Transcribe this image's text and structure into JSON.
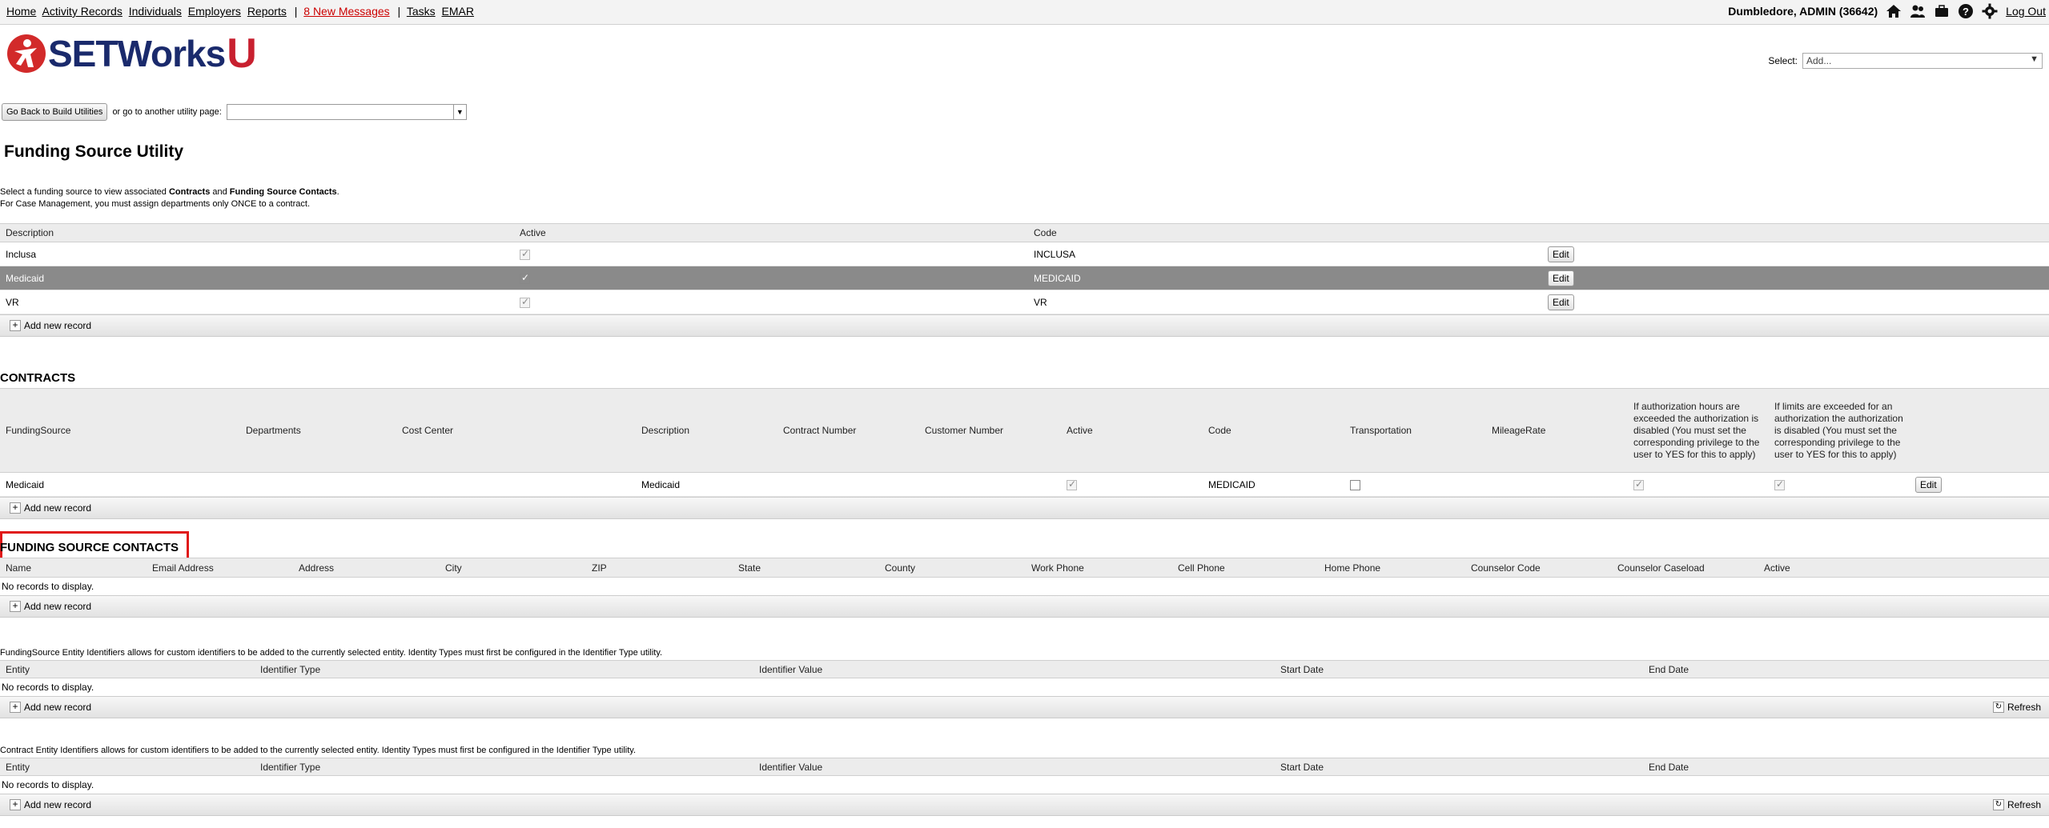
{
  "nav": {
    "links": [
      "Home",
      "Activity Records",
      "Individuals",
      "Employers",
      "Reports"
    ],
    "messages": "8 New Messages",
    "links2": [
      "Tasks",
      "EMAR"
    ],
    "user": "Dumbledore, ADMIN (36642)",
    "logout": "Log Out",
    "icons": [
      "home-icon",
      "people-icon",
      "briefcase-icon",
      "help-icon",
      "gear-icon"
    ]
  },
  "logo": {
    "text": "SETWorks",
    "u": "U"
  },
  "select": {
    "label": "Select:",
    "value": "Add..."
  },
  "utility": {
    "back_button": "Go Back to Build Utilities",
    "or_text": "or go to another utility page:",
    "select_value": ""
  },
  "page_title": "Funding Source Utility",
  "intro": {
    "line1_a": "Select a funding source to view associated ",
    "line1_b": "Contracts",
    "line1_c": " and ",
    "line1_d": "Funding Source Contacts",
    "line1_e": ".",
    "line2": "For Case Management, you must assign departments only ONCE to a contract."
  },
  "funding_grid": {
    "headers": [
      "Description",
      "Active",
      "Code",
      ""
    ],
    "rows": [
      {
        "description": "Inclusa",
        "active": true,
        "code": "INCLUSA",
        "edit": "Edit"
      },
      {
        "description": "Medicaid",
        "active": true,
        "code": "MEDICAID",
        "edit": "Edit"
      },
      {
        "description": "VR",
        "active": true,
        "code": "VR",
        "edit": "Edit"
      }
    ],
    "add": "Add new record"
  },
  "contracts": {
    "title": "CONTRACTS",
    "headers": [
      "FundingSource",
      "Departments",
      "Cost Center",
      "Description",
      "Contract Number",
      "Customer Number",
      "Active",
      "Code",
      "Transportation",
      "MileageRate",
      "If authorization hours are exceeded the authorization is disabled (You must set the corresponding privilege to the user to YES for this to apply)",
      "If limits are exceeded for an authorization the authorization is disabled (You must set the corresponding privilege to the user to YES for this to apply)",
      ""
    ],
    "row": {
      "funding": "Medicaid",
      "departments": "",
      "cost_center": "",
      "description": "Medicaid",
      "contract_number": "",
      "customer_number": "",
      "active": true,
      "code": "MEDICAID",
      "transportation": false,
      "mileage": "",
      "auth_hours": true,
      "auth_limits": true,
      "edit": "Edit"
    },
    "add": "Add new record"
  },
  "contacts": {
    "title": "FUNDING SOURCE CONTACTS",
    "headers": [
      "Name",
      "Email Address",
      "Address",
      "City",
      "ZIP",
      "State",
      "County",
      "Work Phone",
      "Cell Phone",
      "Home Phone",
      "Counselor Code",
      "Counselor Caseload",
      "Active",
      ""
    ],
    "empty": "No records to display.",
    "add": "Add new record"
  },
  "fs_identifiers": {
    "note": "FundingSource Entity Identifiers allows for custom identifiers to be added to the currently selected entity. Identity Types must first be configured in the Identifier Type utility.",
    "headers": [
      "Entity",
      "Identifier Type",
      "Identifier Value",
      "Start Date",
      "End Date"
    ],
    "empty": "No records to display.",
    "add": "Add new record",
    "refresh": "Refresh"
  },
  "contract_identifiers": {
    "note": "Contract Entity Identifiers allows for custom identifiers to be added to the currently selected entity. Identity Types must first be configured in the Identifier Type utility.",
    "headers": [
      "Entity",
      "Identifier Type",
      "Identifier Value",
      "Start Date",
      "End Date"
    ],
    "empty": "No records to display.",
    "add": "Add new record",
    "refresh": "Refresh"
  }
}
